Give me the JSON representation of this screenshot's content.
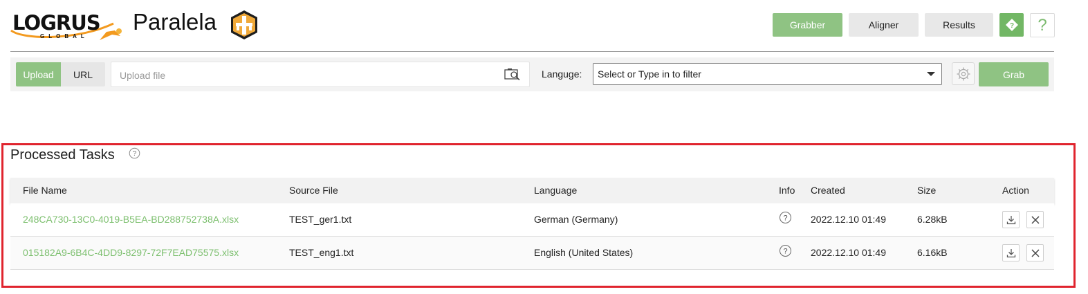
{
  "header": {
    "logo_text": "LOGRUS",
    "logo_subtext": "GLOBAL",
    "app_title": "Paralela",
    "nav": {
      "grabber": "Grabber",
      "aligner": "Aligner",
      "results": "Results",
      "help": "?"
    }
  },
  "toolbar": {
    "upload_tab": "Upload",
    "url_tab": "URL",
    "upload_placeholder": "Upload file",
    "language_label": "Languge:",
    "language_select": "Select or Type in to filter",
    "grab_button": "Grab"
  },
  "tasks": {
    "title": "Processed Tasks",
    "columns": [
      "File Name",
      "Source File",
      "Language",
      "Info",
      "Created",
      "Size",
      "Action"
    ],
    "rows": [
      {
        "file_name": "248CA730-13C0-4019-B5EA-BD288752738A.xlsx",
        "source_file": "TEST_ger1.txt",
        "language": "German (Germany)",
        "created": "2022.12.10 01:49",
        "size": "6.28kB"
      },
      {
        "file_name": "015182A9-6B4C-4DD9-8297-72F7EAD75575.xlsx",
        "source_file": "TEST_eng1.txt",
        "language": "English (United States)",
        "created": "2022.12.10 01:49",
        "size": "6.16kB"
      }
    ]
  },
  "colors": {
    "accent_green": "#8fc383",
    "link_green": "#7cbf6e",
    "highlight_red": "#e0242e"
  },
  "icons": {
    "upload": "image-search-icon",
    "settings": "gear-icon",
    "info": "question-circle-icon",
    "download": "download-icon",
    "delete": "close-icon"
  }
}
